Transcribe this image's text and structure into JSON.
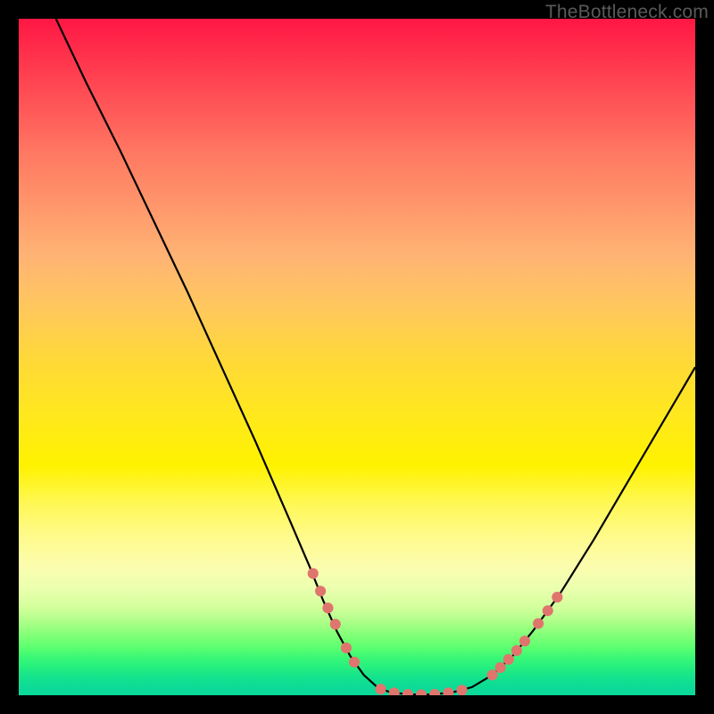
{
  "watermark": "TheBottleneck.com",
  "chart_data": {
    "type": "line",
    "title": "",
    "xlabel": "",
    "ylabel": "",
    "xlim": [
      0,
      100
    ],
    "ylim": [
      0,
      100
    ],
    "curve": {
      "name": "bottleneck-curve",
      "points": [
        {
          "x": 5.5,
          "y": 100
        },
        {
          "x": 10,
          "y": 90.5
        },
        {
          "x": 15,
          "y": 80.5
        },
        {
          "x": 20,
          "y": 70
        },
        {
          "x": 25,
          "y": 59.5
        },
        {
          "x": 30,
          "y": 48.5
        },
        {
          "x": 35,
          "y": 37.5
        },
        {
          "x": 40,
          "y": 26
        },
        {
          "x": 43,
          "y": 19
        },
        {
          "x": 45,
          "y": 14
        },
        {
          "x": 47,
          "y": 9.5
        },
        {
          "x": 49,
          "y": 5.8
        },
        {
          "x": 51,
          "y": 3
        },
        {
          "x": 53,
          "y": 1.2
        },
        {
          "x": 55,
          "y": 0.4
        },
        {
          "x": 58,
          "y": 0.1
        },
        {
          "x": 61,
          "y": 0.1
        },
        {
          "x": 64,
          "y": 0.4
        },
        {
          "x": 67,
          "y": 1.2
        },
        {
          "x": 70,
          "y": 3
        },
        {
          "x": 73,
          "y": 5.8
        },
        {
          "x": 76,
          "y": 9.5
        },
        {
          "x": 80,
          "y": 15
        },
        {
          "x": 85,
          "y": 23
        },
        {
          "x": 90,
          "y": 31.5
        },
        {
          "x": 95,
          "y": 40
        },
        {
          "x": 100,
          "y": 48.5
        }
      ]
    },
    "dots_left": [
      {
        "x": 43.5,
        "y": 18.0
      },
      {
        "x": 44.6,
        "y": 15.4
      },
      {
        "x": 45.7,
        "y": 12.9
      },
      {
        "x": 46.8,
        "y": 10.5
      },
      {
        "x": 48.4,
        "y": 7.0
      },
      {
        "x": 49.6,
        "y": 4.9
      }
    ],
    "dots_bottom": [
      {
        "x": 53.5,
        "y": 0.9
      },
      {
        "x": 55.5,
        "y": 0.35
      },
      {
        "x": 57.5,
        "y": 0.12
      },
      {
        "x": 59.5,
        "y": 0.08
      },
      {
        "x": 61.5,
        "y": 0.14
      },
      {
        "x": 63.5,
        "y": 0.36
      },
      {
        "x": 65.5,
        "y": 0.75
      }
    ],
    "dots_right": [
      {
        "x": 70.0,
        "y": 3.0
      },
      {
        "x": 71.2,
        "y": 4.1
      },
      {
        "x": 72.4,
        "y": 5.3
      },
      {
        "x": 73.6,
        "y": 6.6
      },
      {
        "x": 74.8,
        "y": 8.0
      },
      {
        "x": 76.8,
        "y": 10.6
      },
      {
        "x": 78.2,
        "y": 12.5
      },
      {
        "x": 79.6,
        "y": 14.5
      }
    ],
    "dot_radius_pct": 0.8
  }
}
